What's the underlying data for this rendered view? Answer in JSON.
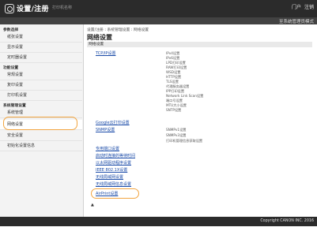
{
  "header": {
    "title": "设置/注册",
    "info": "打印机名称",
    "portal_link": "门户",
    "logout_link": "注销",
    "to_mgmt_link": "至系统管理员模式"
  },
  "sidebar": {
    "groups": [
      {
        "heading": "参数选择",
        "items": [
          {
            "label": "纸张设置"
          },
          {
            "label": "显示设置"
          },
          {
            "label": "定时器设置"
          }
        ]
      },
      {
        "heading": "功能设置",
        "items": [
          {
            "label": "常规设置"
          },
          {
            "label": "复印设置"
          },
          {
            "label": "打印机设置"
          }
        ]
      },
      {
        "heading": "系统管理设置",
        "items": [
          {
            "label": "系统管理"
          },
          {
            "label": "网络设置",
            "active": true
          },
          {
            "label": "安全设置"
          },
          {
            "label": "初始化设置信息"
          }
        ]
      }
    ]
  },
  "main": {
    "breadcrumb": "设置/注册 : 系统管理设置 : 网络设置",
    "title": "网络设置",
    "section_label": "网络设置",
    "tcpip_link": "TCP/IP设置",
    "tcpip_subitems": [
      "IPv4设置",
      "IPv6设置",
      "LPD打印设置",
      "RAW打印设置",
      "WSD设置",
      "HTTP设置",
      "TLS设置",
      "代理服务器设置",
      "IPP打印设置",
      "Network Link Scan设置",
      "端口号设置",
      "MTU大小设置",
      "SNTP设置"
    ],
    "gcp_link": "Google云打印设置",
    "snmp_link": "SNMP设置",
    "snmp_subitems": [
      "SNMPv1设置",
      "SNMPv3设置",
      "打印机管理信息获取设置"
    ],
    "other_links": [
      "专用端口设置",
      "启动时连接的等待时间",
      "以太网驱动程序设置",
      "IEEE 802.1X设置",
      "无线局域网设置",
      "无线局域网信息设置",
      "AirPrint设置"
    ],
    "top_link": "▲"
  },
  "footer": {
    "copyright": "Copyright CANON INC. 2016"
  },
  "colors": {
    "header_bg": "#2b2b2b",
    "link": "#1a4ba8",
    "highlight": "#f2a541"
  }
}
